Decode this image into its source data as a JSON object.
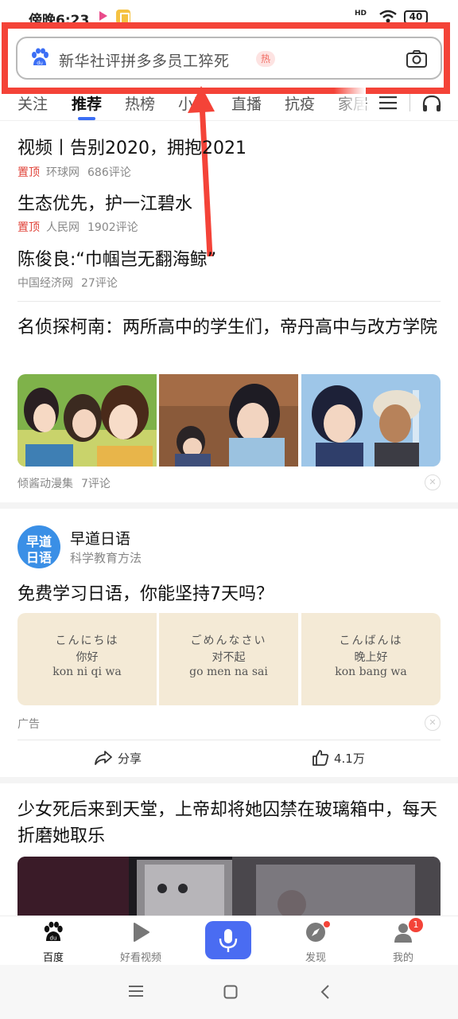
{
  "status_bar": {
    "time": "傍晚6:23",
    "network": "HD",
    "battery": "40"
  },
  "search": {
    "query": "新华社评拼多多员工猝死",
    "hot_badge": "热"
  },
  "tabs": [
    {
      "label": "关注"
    },
    {
      "label": "推荐"
    },
    {
      "label": "热榜"
    },
    {
      "label": "小说"
    },
    {
      "label": "直播"
    },
    {
      "label": "抗疫"
    },
    {
      "label": "家居"
    }
  ],
  "pinned_news": [
    {
      "title": "视频丨告别2020，拥抱2021",
      "tag": "置顶",
      "source": "环球网",
      "comments": "686评论"
    },
    {
      "title": "生态优先，护一江碧水",
      "tag": "置顶",
      "source": "人民网",
      "comments": "1902评论"
    },
    {
      "title": "陈俊良:“巾帼岂无翻海鲸”",
      "tag": "",
      "source": "中国经济网",
      "comments": "27评论"
    }
  ],
  "article1": {
    "title": "名侦探柯南：两所高中的学生们，帝丹高中与改方学院",
    "source": "倾酱动漫集",
    "comments": "7评论"
  },
  "ad_card": {
    "avatar_line1": "早道",
    "avatar_line2": "日语",
    "name": "早道日语",
    "desc": "科学教育方法",
    "title": "免费学习日语，你能坚持7天吗？",
    "panels": [
      {
        "jp": "こんにちは",
        "cn": "你好",
        "romaji": "kon ni qi wa"
      },
      {
        "jp": "ごめんなさい",
        "cn": "对不起",
        "romaji": "go men na sai"
      },
      {
        "jp": "こんばんは",
        "cn": "晚上好",
        "romaji": "kon bang wa"
      }
    ],
    "ad_label": "广告",
    "share_label": "分享",
    "like_count": "4.1万"
  },
  "article2": {
    "title": "少女死后来到天堂，上帝却将她囚禁在玻璃箱中，每天折磨她取乐"
  },
  "bottom_nav": {
    "items": [
      {
        "label": "百度",
        "icon": "baidu-paw-icon"
      },
      {
        "label": "好看视频",
        "icon": "play-icon"
      },
      {
        "label": "",
        "icon": "microphone-icon"
      },
      {
        "label": "发现",
        "icon": "compass-icon"
      },
      {
        "label": "我的",
        "icon": "user-icon"
      }
    ],
    "mine_badge": "1"
  },
  "colors": {
    "accent": "#4a6cf2",
    "annotation": "#f44338",
    "pin": "#e0443a"
  }
}
